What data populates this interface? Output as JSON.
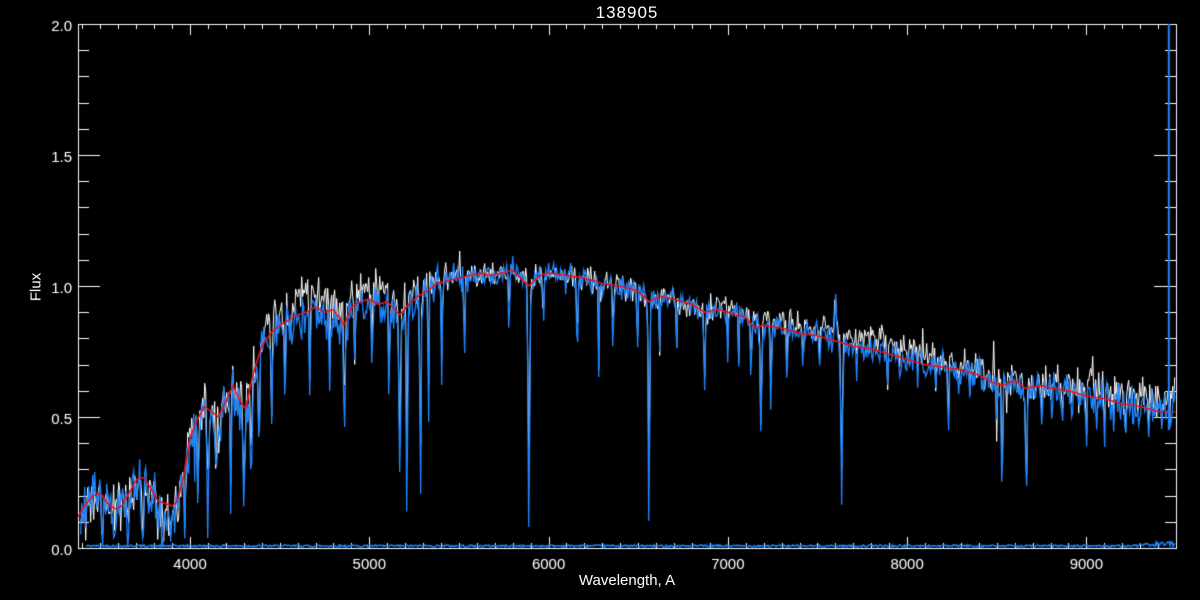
{
  "window": {
    "background": "#000000"
  },
  "chart_data": {
    "type": "line",
    "title": "138905",
    "xlabel": "Wavelength, A",
    "ylabel": "Flux",
    "xlim": [
      3375,
      9500
    ],
    "ylim": [
      0.0,
      2.0
    ],
    "x_ticks": [
      4000,
      5000,
      6000,
      7000,
      8000,
      9000
    ],
    "x_tick_labels": [
      "4000",
      "5000",
      "6000",
      "7000",
      "8000",
      "9000"
    ],
    "x_minor_step": 100,
    "y_ticks": [
      0.0,
      0.5,
      1.0,
      1.5,
      2.0
    ],
    "y_tick_labels": [
      "0.0",
      "0.5",
      "1.0",
      "1.5",
      "2.0"
    ],
    "y_minor_step": 0.1,
    "grid": false,
    "legend": "none",
    "axis_color": "#ffffff",
    "background_color": "#000000",
    "series": [
      {
        "name": "observed-spectrum-secondary",
        "role": "noisy observed spectrum drawn behind",
        "color": "#ffffff"
      },
      {
        "name": "observed-spectrum-primary",
        "role": "noisy observed spectrum drawn in front",
        "color": "#1e86ff"
      },
      {
        "name": "model-fit",
        "role": "smooth template/model fit",
        "color": "#e81414"
      },
      {
        "name": "error-spectrum",
        "role": "noise level along flux=0",
        "color": "#1e86ff",
        "level_flux": 0.008
      }
    ],
    "model_points": [
      [
        3375,
        0.12
      ],
      [
        3420,
        0.17
      ],
      [
        3460,
        0.2
      ],
      [
        3500,
        0.21
      ],
      [
        3540,
        0.17
      ],
      [
        3580,
        0.15
      ],
      [
        3620,
        0.16
      ],
      [
        3660,
        0.21
      ],
      [
        3700,
        0.26
      ],
      [
        3740,
        0.27
      ],
      [
        3780,
        0.23
      ],
      [
        3820,
        0.18
      ],
      [
        3860,
        0.17
      ],
      [
        3900,
        0.16
      ],
      [
        3930,
        0.18
      ],
      [
        3960,
        0.26
      ],
      [
        4000,
        0.42
      ],
      [
        4040,
        0.49
      ],
      [
        4080,
        0.54
      ],
      [
        4120,
        0.52
      ],
      [
        4160,
        0.5
      ],
      [
        4200,
        0.56
      ],
      [
        4240,
        0.62
      ],
      [
        4280,
        0.56
      ],
      [
        4310,
        0.53
      ],
      [
        4350,
        0.66
      ],
      [
        4400,
        0.77
      ],
      [
        4450,
        0.82
      ],
      [
        4500,
        0.85
      ],
      [
        4550,
        0.87
      ],
      [
        4600,
        0.89
      ],
      [
        4650,
        0.9
      ],
      [
        4700,
        0.92
      ],
      [
        4750,
        0.9
      ],
      [
        4800,
        0.91
      ],
      [
        4860,
        0.85
      ],
      [
        4900,
        0.92
      ],
      [
        4950,
        0.94
      ],
      [
        5000,
        0.95
      ],
      [
        5050,
        0.93
      ],
      [
        5100,
        0.94
      ],
      [
        5170,
        0.89
      ],
      [
        5220,
        0.93
      ],
      [
        5270,
        0.96
      ],
      [
        5320,
        0.98
      ],
      [
        5380,
        1.01
      ],
      [
        5440,
        1.02
      ],
      [
        5500,
        1.03
      ],
      [
        5560,
        1.04
      ],
      [
        5620,
        1.05
      ],
      [
        5680,
        1.04
      ],
      [
        5740,
        1.05
      ],
      [
        5800,
        1.06
      ],
      [
        5890,
        1.0
      ],
      [
        5950,
        1.04
      ],
      [
        6000,
        1.05
      ],
      [
        6100,
        1.04
      ],
      [
        6200,
        1.03
      ],
      [
        6300,
        1.01
      ],
      [
        6400,
        1.0
      ],
      [
        6500,
        0.98
      ],
      [
        6560,
        0.94
      ],
      [
        6620,
        0.96
      ],
      [
        6700,
        0.95
      ],
      [
        6800,
        0.93
      ],
      [
        6870,
        0.9
      ],
      [
        6950,
        0.91
      ],
      [
        7000,
        0.9
      ],
      [
        7100,
        0.88
      ],
      [
        7150,
        0.84
      ],
      [
        7200,
        0.85
      ],
      [
        7300,
        0.84
      ],
      [
        7400,
        0.82
      ],
      [
        7500,
        0.81
      ],
      [
        7600,
        0.79
      ],
      [
        7700,
        0.77
      ],
      [
        7800,
        0.76
      ],
      [
        7900,
        0.74
      ],
      [
        8000,
        0.72
      ],
      [
        8100,
        0.7
      ],
      [
        8200,
        0.69
      ],
      [
        8300,
        0.68
      ],
      [
        8400,
        0.66
      ],
      [
        8480,
        0.63
      ],
      [
        8540,
        0.62
      ],
      [
        8600,
        0.64
      ],
      [
        8660,
        0.61
      ],
      [
        8750,
        0.62
      ],
      [
        8800,
        0.61
      ],
      [
        8900,
        0.6
      ],
      [
        9000,
        0.58
      ],
      [
        9100,
        0.57
      ],
      [
        9200,
        0.55
      ],
      [
        9300,
        0.54
      ],
      [
        9400,
        0.52
      ],
      [
        9500,
        0.52
      ]
    ],
    "absorption_lines": [
      [
        3420,
        0.05,
        8
      ],
      [
        3510,
        0.03,
        9
      ],
      [
        3580,
        0.06,
        8
      ],
      [
        3655,
        0.03,
        10
      ],
      [
        3735,
        0.02,
        12
      ],
      [
        3770,
        0.08,
        8
      ],
      [
        3820,
        0.05,
        10
      ],
      [
        3850,
        0.03,
        14
      ],
      [
        3890,
        0.05,
        16
      ],
      [
        3935,
        0.1,
        10
      ],
      [
        3970,
        0.12,
        10
      ],
      [
        4045,
        0.15,
        8
      ],
      [
        4100,
        0.1,
        10
      ],
      [
        4145,
        0.22,
        8
      ],
      [
        4227,
        0.15,
        8
      ],
      [
        4300,
        0.18,
        12
      ],
      [
        4340,
        0.25,
        10
      ],
      [
        4385,
        0.32,
        8
      ],
      [
        4455,
        0.48,
        8
      ],
      [
        4530,
        0.52,
        8
      ],
      [
        4668,
        0.55,
        8
      ],
      [
        4780,
        0.6,
        6
      ],
      [
        4861,
        0.45,
        10
      ],
      [
        4920,
        0.62,
        6
      ],
      [
        5015,
        0.6,
        6
      ],
      [
        5110,
        0.52,
        6
      ],
      [
        5170,
        0.25,
        10
      ],
      [
        5210,
        0.12,
        8
      ],
      [
        5285,
        0.1,
        7
      ],
      [
        5330,
        0.45,
        6
      ],
      [
        5405,
        0.55,
        6
      ],
      [
        5530,
        0.65,
        6
      ],
      [
        5780,
        0.7,
        5
      ],
      [
        5890,
        0.1,
        10
      ],
      [
        5970,
        0.72,
        5
      ],
      [
        6160,
        0.65,
        6
      ],
      [
        6280,
        0.62,
        5
      ],
      [
        6360,
        0.68,
        5
      ],
      [
        6495,
        0.62,
        5
      ],
      [
        6560,
        0.04,
        8
      ],
      [
        6620,
        0.7,
        5
      ],
      [
        6715,
        0.72,
        5
      ],
      [
        6870,
        0.58,
        9
      ],
      [
        7000,
        0.7,
        5
      ],
      [
        7060,
        0.68,
        5
      ],
      [
        7130,
        0.6,
        6
      ],
      [
        7185,
        0.38,
        8
      ],
      [
        7240,
        0.5,
        7
      ],
      [
        7330,
        0.62,
        6
      ],
      [
        7420,
        0.65,
        5
      ],
      [
        7510,
        0.66,
        5
      ],
      [
        7635,
        0.16,
        10
      ],
      [
        7720,
        0.62,
        5
      ],
      [
        7890,
        0.58,
        6
      ],
      [
        7960,
        0.64,
        5
      ],
      [
        8060,
        0.62,
        5
      ],
      [
        8160,
        0.6,
        5
      ],
      [
        8230,
        0.42,
        7
      ],
      [
        8290,
        0.58,
        5
      ],
      [
        8350,
        0.55,
        5
      ],
      [
        8430,
        0.6,
        5
      ],
      [
        8500,
        0.42,
        6
      ],
      [
        8530,
        0.18,
        7
      ],
      [
        8620,
        0.55,
        5
      ],
      [
        8665,
        0.14,
        8
      ],
      [
        8750,
        0.48,
        5
      ],
      [
        8805,
        0.55,
        5
      ],
      [
        8865,
        0.4,
        6
      ],
      [
        8920,
        0.5,
        5
      ],
      [
        9000,
        0.35,
        6
      ],
      [
        9060,
        0.45,
        5
      ],
      [
        9100,
        0.32,
        6
      ],
      [
        9150,
        0.38,
        5
      ],
      [
        9220,
        0.4,
        5
      ],
      [
        9290,
        0.45,
        5
      ],
      [
        9350,
        0.42,
        5
      ],
      [
        9420,
        0.45,
        5
      ]
    ],
    "emission_feature": {
      "wavelength": 7600,
      "peak_flux": 0.97,
      "width": 10
    },
    "edge_spike": {
      "wavelength": 9460,
      "flux_from": 0.45,
      "flux_to": 2.0
    },
    "noise_profile": [
      [
        3375,
        0.05
      ],
      [
        3700,
        0.055
      ],
      [
        3950,
        0.05
      ],
      [
        4100,
        0.055
      ],
      [
        4400,
        0.05
      ],
      [
        4800,
        0.045
      ],
      [
        5200,
        0.04
      ],
      [
        5600,
        0.032
      ],
      [
        6000,
        0.028
      ],
      [
        6500,
        0.027
      ],
      [
        7000,
        0.028
      ],
      [
        7500,
        0.03
      ],
      [
        8000,
        0.032
      ],
      [
        8400,
        0.035
      ],
      [
        8800,
        0.04
      ],
      [
        9100,
        0.045
      ],
      [
        9500,
        0.055
      ]
    ],
    "white_offset_profile": [
      [
        3375,
        0.0
      ],
      [
        4300,
        0.01
      ],
      [
        4450,
        0.04
      ],
      [
        4700,
        0.06
      ],
      [
        5000,
        0.05
      ],
      [
        5150,
        0.03
      ],
      [
        5350,
        0.01
      ],
      [
        5600,
        0.0
      ],
      [
        6800,
        0.0
      ],
      [
        7100,
        0.02
      ],
      [
        7400,
        0.035
      ],
      [
        7800,
        0.045
      ],
      [
        8100,
        0.04
      ],
      [
        8350,
        0.025
      ],
      [
        8600,
        0.01
      ],
      [
        8900,
        0.015
      ],
      [
        9150,
        0.04
      ],
      [
        9500,
        0.06
      ]
    ],
    "blue_offset_profile": [
      [
        3375,
        0.0
      ],
      [
        4400,
        -0.015
      ],
      [
        4750,
        -0.03
      ],
      [
        5100,
        -0.015
      ],
      [
        5400,
        0.0
      ],
      [
        9500,
        0.0
      ]
    ]
  }
}
